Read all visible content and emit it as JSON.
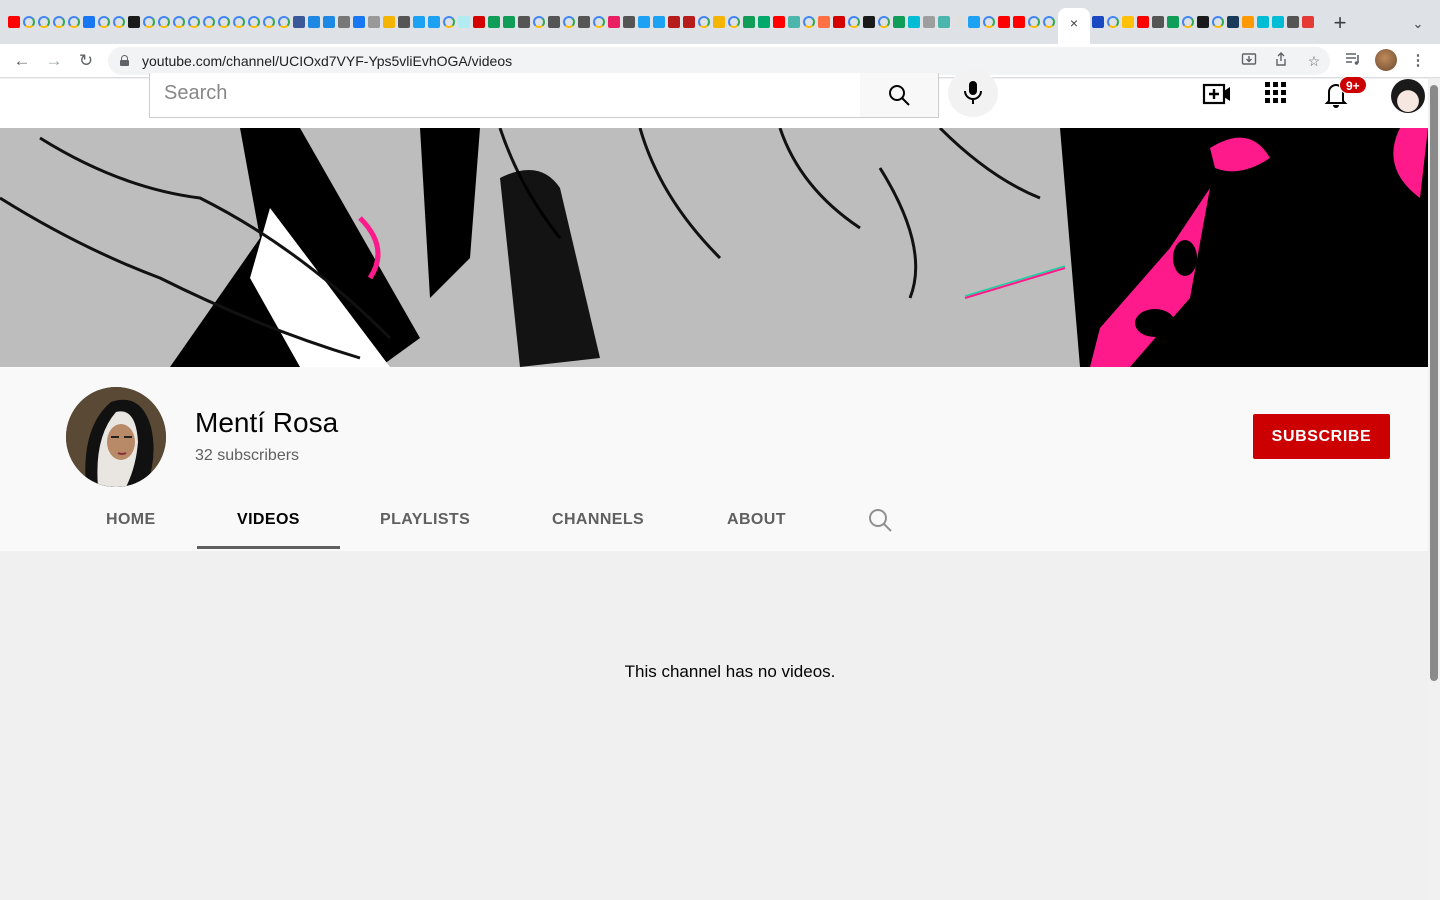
{
  "browser": {
    "url": "youtube.com/channel/UCIOxd7VYF-Yps5vliEvhOGA/videos",
    "tab_close_glyph": "×",
    "new_tab_glyph": "+",
    "tab_menu_glyph": "⌄"
  },
  "masthead": {
    "search_placeholder": "Search",
    "notification_count": "9+"
  },
  "channel": {
    "name": "Mentí Rosa",
    "subscribers": "32 subscribers",
    "subscribe_label": "SUBSCRIBE",
    "tabs": [
      {
        "label": "HOME"
      },
      {
        "label": "VIDEOS",
        "active": true
      },
      {
        "label": "PLAYLISTS"
      },
      {
        "label": "CHANNELS"
      },
      {
        "label": "ABOUT"
      }
    ]
  },
  "content": {
    "empty_message": "This channel has no videos."
  },
  "colors": {
    "subscribe_red": "#cc0000",
    "banner_pink": "#ff1a8c",
    "banner_black": "#000000"
  }
}
